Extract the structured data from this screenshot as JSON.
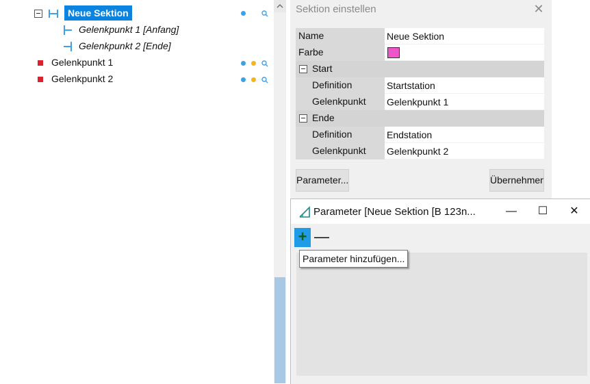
{
  "tree": {
    "root_label": "Neue Sektion",
    "child1_label": "Gelenkpunkt 1 [Anfang]",
    "child2_label": "Gelenkpunkt 2 [Ende]",
    "item1_label": "Gelenkpunkt 1",
    "item2_label": "Gelenkpunkt 2"
  },
  "dialog1": {
    "title": "Sektion einstellen",
    "close_glyph": "✕",
    "rows": {
      "name_label": "Name",
      "name_value": "Neue Sektion",
      "farbe_label": "Farbe",
      "farbe_color": "#ee55c8",
      "start_label": "Start",
      "start_def_label": "Definition",
      "start_def_value": "Startstation",
      "start_gp_label": "Gelenkpunkt",
      "start_gp_value": "Gelenkpunkt 1",
      "ende_label": "Ende",
      "ende_def_label": "Definition",
      "ende_def_value": "Endstation",
      "ende_gp_label": "Gelenkpunkt",
      "ende_gp_value": "Gelenkpunkt 2"
    },
    "param_button": "Parameter...",
    "apply_button": "Übernehmen"
  },
  "dialog2": {
    "title": "Parameter [Neue Sektion [B 123n...",
    "minimize_glyph": "—",
    "maximize_glyph": "☐",
    "close_glyph": "✕",
    "add_glyph": "+",
    "remove_glyph": "—",
    "tooltip": "Parameter hinzufügen..."
  },
  "colors": {
    "selection": "#0a84e0",
    "accent_blue": "#3ea0e6",
    "accent_yellow": "#f0b429",
    "marker_red": "#d9232e"
  }
}
